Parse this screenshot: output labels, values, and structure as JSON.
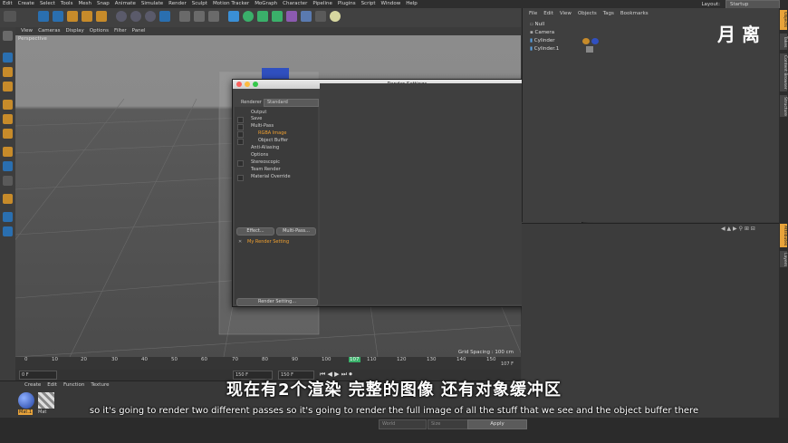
{
  "menubar": [
    "Edit",
    "Create",
    "Select",
    "Tools",
    "Mesh",
    "Snap",
    "Animate",
    "Simulate",
    "Render",
    "Sculpt",
    "Motion Tracker",
    "MoGraph",
    "Character",
    "Pipeline",
    "Plugins",
    "Script",
    "Window",
    "Help"
  ],
  "layout": {
    "label": "Layout:",
    "value": "Startup"
  },
  "viewport_menu": [
    "View",
    "Cameras",
    "Display",
    "Options",
    "Filter",
    "Panel"
  ],
  "viewport_label": "Perspective",
  "grid_spacing": "Grid Spacing : 100 cm",
  "object_manager": {
    "menu": [
      "File",
      "Edit",
      "View",
      "Objects",
      "Tags",
      "Bookmarks"
    ],
    "objects": [
      "Null",
      "Camera",
      "Cylinder",
      "Cylinder.1"
    ]
  },
  "side_tabs": [
    "Objects",
    "Takes",
    "Content Browser",
    "Structure",
    "Attributes",
    "Layers"
  ],
  "timeline": {
    "ticks": [
      "0",
      "10",
      "20",
      "30",
      "40",
      "50",
      "60",
      "70",
      "80",
      "90",
      "100",
      "107",
      "110",
      "120",
      "130",
      "140",
      "150"
    ],
    "end_label": "107 F",
    "current_label": "107",
    "frame_start": "0 F",
    "frame_field": "0 F",
    "frame_end": "150 F",
    "frame_end2": "150 F"
  },
  "material_manager": {
    "menu": [
      "Create",
      "Edit",
      "Function",
      "Texture"
    ],
    "materials": [
      "Mat.1",
      "Mat"
    ]
  },
  "bottom": {
    "apply": "Apply",
    "dropdown1": "World",
    "dropdown2": "Size"
  },
  "dialog": {
    "title": "Render Settings",
    "renderer_label": "Renderer",
    "renderer_value": "Standard",
    "tree": [
      "Output",
      "Save",
      "Multi-Pass",
      "RGBA Image",
      "Object Buffer",
      "Anti-Aliasing",
      "Options",
      "Stereoscopic",
      "Team Render",
      "Material Override"
    ],
    "effect_button": "Effect...",
    "multipass_button": "Multi-Pass...",
    "render_setting_name": "My Render Setting",
    "render_setting_button": "Render Setting..."
  },
  "subtitles": {
    "chinese": "现在有2个渲染 完整的图像 还有对象缓冲区",
    "english": "so it's going to render two different passes so it's going to render the full image of all the stuff that we see and the object buffer there"
  },
  "watermark": "月 离",
  "colors": {
    "accent": "#e8a33a",
    "selected_text": "#f0a030",
    "dialog_bg": "#444444"
  }
}
